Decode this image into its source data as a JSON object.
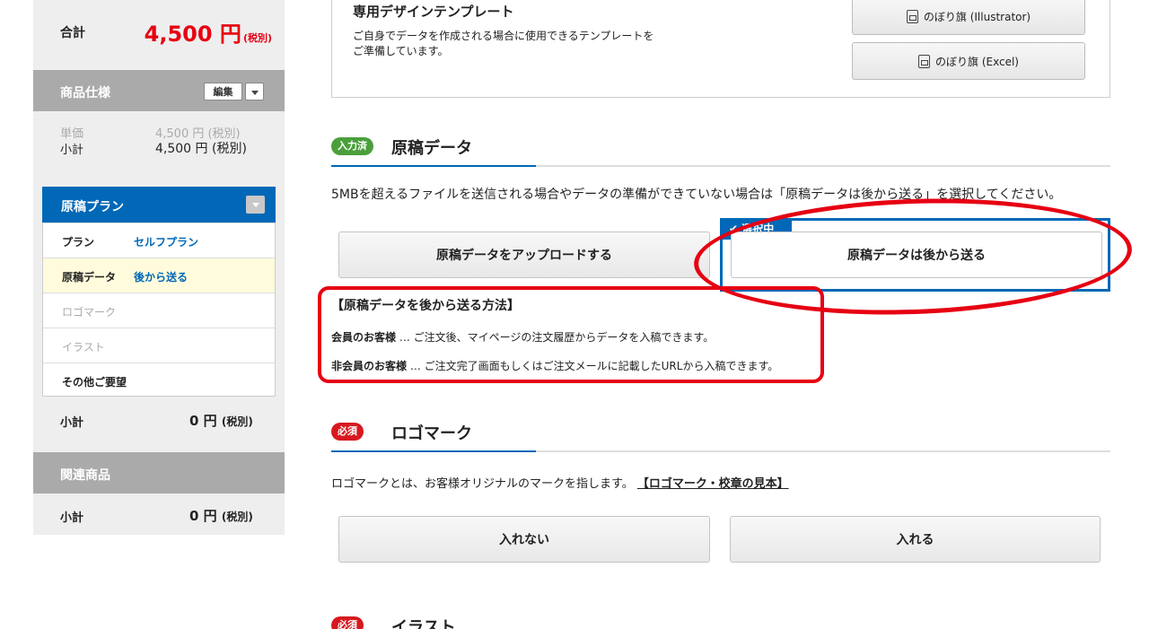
{
  "sidebar": {
    "total": {
      "label": "合計",
      "amount": "4,500 円",
      "tax": "(税別)"
    },
    "spec": {
      "title": "商品仕様",
      "edit_label": "編集",
      "unit_price_label": "単価",
      "unit_price_value": "4,500 円 (税別)",
      "subtotal_label": "小計",
      "subtotal_value": "4,500 円 (税別)"
    },
    "plan": {
      "title": "原稿プラン",
      "rows": [
        {
          "key": "プラン",
          "value": "セルフプラン"
        },
        {
          "key": "原稿データ",
          "value": "後から送る"
        },
        {
          "key": "ロゴマーク",
          "value": ""
        },
        {
          "key": "イラスト",
          "value": ""
        },
        {
          "key": "その他ご要望",
          "value": ""
        }
      ],
      "subtotal_label": "小計",
      "subtotal_value": "0 円",
      "subtotal_tax": "(税別)"
    },
    "related": {
      "title": "関連商品",
      "subtotal_label": "小計",
      "subtotal_value": "0 円",
      "subtotal_tax": "(税別)"
    }
  },
  "template": {
    "title": "専用デザインテンプレート",
    "desc_line1": "ご自身でデータを作成される場合に使用できるテンプレートを",
    "desc_line2": "ご準備しています。",
    "btn_illustrator": "のぼり旗 (Illustrator)",
    "btn_excel": "のぼり旗 (Excel)"
  },
  "manuscript": {
    "badge": "入力済",
    "title": "原稿データ",
    "notice": "5MBを超えるファイルを送信される場合やデータの準備ができていない場合は「原稿データは後から送る」を選択してください。",
    "upload_label": "原稿データをアップロードする",
    "later_label": "原稿データは後から送る",
    "selected_tag": "✔ 選択中",
    "method_title": "【原稿データを後から送る方法】",
    "member_label": "会員のお客様",
    "member_text": " … ご注文後、マイページの注文履歴からデータを入稿できます。",
    "guest_label": "非会員のお客様",
    "guest_text": " … ご注文完了画面もしくはご注文メールに記載したURLから入稿できます。"
  },
  "logomark": {
    "badge": "必須",
    "title": "ロゴマーク",
    "notice": "ロゴマークとは、お客様オリジナルのマークを指します。",
    "link": "【ロゴマーク・校章の見本】",
    "no_label": "入れない",
    "yes_label": "入れる"
  },
  "illust": {
    "badge": "必須",
    "title": "イラスト"
  },
  "colors": {
    "accent_blue": "#0068b7",
    "price_red": "#e60012",
    "badge_green": "#4b9f3b",
    "badge_red": "#d7191f"
  }
}
